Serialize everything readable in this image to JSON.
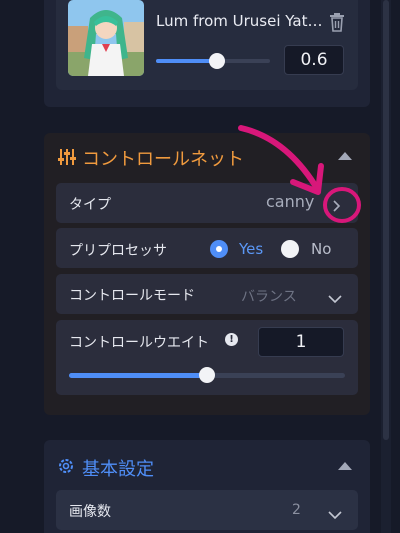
{
  "lora": {
    "name": "Lum from Urusei Yatsura",
    "weight": "0.6",
    "slider_value_fraction": 0.53
  },
  "controlnet": {
    "title": "コントロールネット",
    "type_label": "タイプ",
    "type_value": "canny",
    "preprocessor_label": "プリプロセッサ",
    "yes_label": "Yes",
    "no_label": "No",
    "preprocessor_selected": "Yes",
    "mode_label": "コントロールモード",
    "mode_value": "バランス",
    "weight_label": "コントロールウエイト",
    "info_glyph": "!",
    "weight_value": "1",
    "weight_slider_fraction": 0.5
  },
  "basic": {
    "title": "基本設定",
    "count_label": "画像数",
    "count_value": "2"
  },
  "colors": {
    "accent_blue": "#4f8ef7",
    "accent_orange": "#f09a3e",
    "annotation_magenta": "#d8177a"
  },
  "icons": [
    "trash-icon",
    "sliders-icon",
    "chevron-up-icon",
    "chevron-right-icon",
    "info-icon",
    "chevron-down-icon",
    "gear-icon",
    "arrow-annotation"
  ]
}
